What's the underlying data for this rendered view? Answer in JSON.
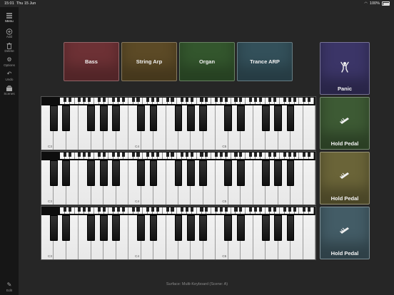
{
  "status_bar": {
    "time": "15:01",
    "date": "Thu 15 Jun",
    "battery": "100%"
  },
  "sidebar": {
    "items": [
      {
        "label": "Menu",
        "icon": "hamburger-icon"
      },
      {
        "label": "Add",
        "icon": "plus-circle-icon"
      },
      {
        "label": "Delete",
        "icon": "trash-icon"
      },
      {
        "label": "Options",
        "icon": "gear-icon"
      },
      {
        "label": "Undo",
        "icon": "undo-icon"
      },
      {
        "label": "Scenes",
        "icon": "scenes-icon"
      }
    ],
    "edit_label": "Edit"
  },
  "scenes": [
    {
      "label": "Bass",
      "color": "#6d3135"
    },
    {
      "label": "String Arp",
      "color": "#5c4a26"
    },
    {
      "label": "Organ",
      "color": "#33562d"
    },
    {
      "label": "Trance ARP",
      "color": "#33505a"
    }
  ],
  "controls": [
    {
      "label": "Panic",
      "color": "#3b3567",
      "icon": "panic-icon"
    },
    {
      "label": "Hold Pedal",
      "color": "#3d5a34",
      "icon": "pedal-icon"
    },
    {
      "label": "Hold Pedal",
      "color": "#6a6438",
      "icon": "pedal-icon"
    },
    {
      "label": "Hold Pedal",
      "color": "#435c66",
      "icon": "pedal-icon"
    }
  ],
  "keyboards": [
    {
      "octave_labels": [
        "C3",
        "C4",
        "C5"
      ]
    },
    {
      "octave_labels": [
        "C3",
        "C4",
        "C5"
      ]
    },
    {
      "octave_labels": [
        "C3",
        "C4",
        "C5"
      ]
    }
  ],
  "footer": "Surface: Multi-Keyboard  (Scene: A)"
}
